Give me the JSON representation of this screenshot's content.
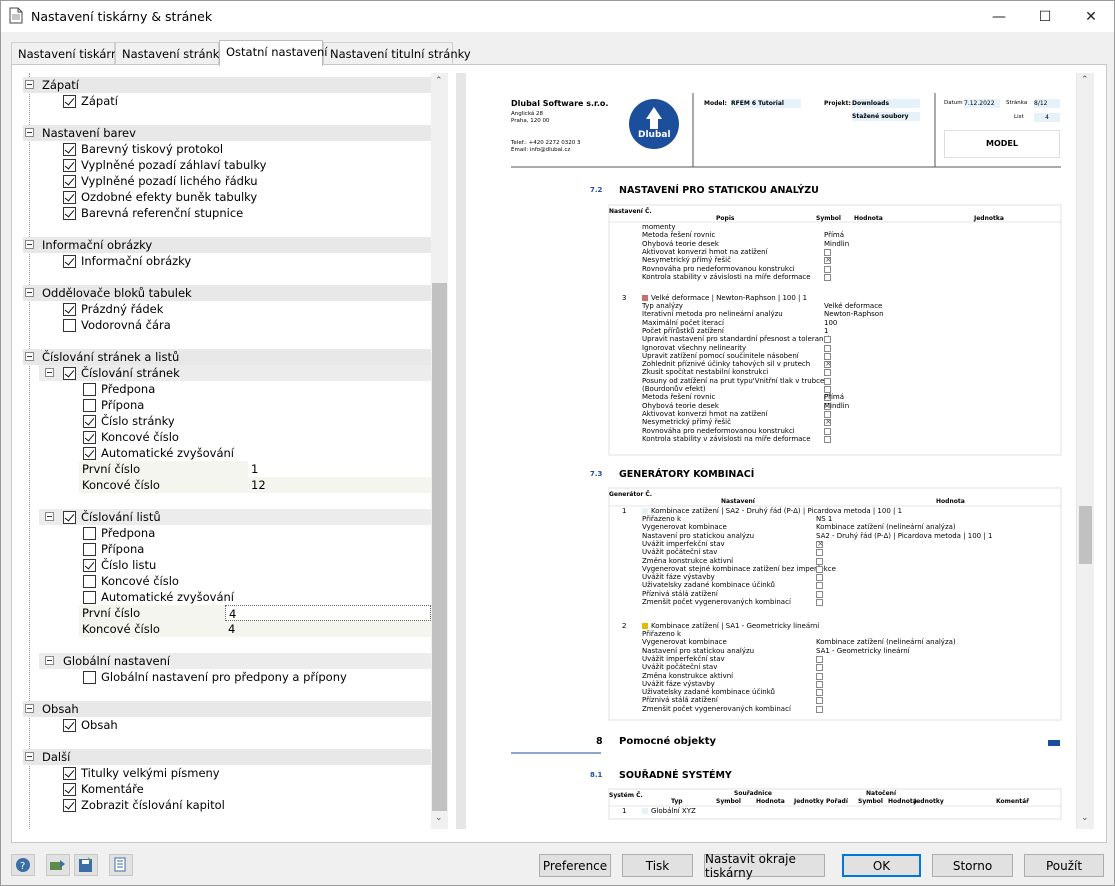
{
  "window": {
    "title": "Nastavení tiskárny & stránek",
    "minimize": "—",
    "maximize": "☐",
    "close": "✕"
  },
  "tabs": [
    "Nastavení tiskárny",
    "Nastavení stránky",
    "Ostatní nastavení",
    "Nastavení titulní stránky"
  ],
  "tree": {
    "zapati": {
      "header": "Zápatí",
      "item": "Zápatí"
    },
    "barvy": {
      "header": "Nastavení barev",
      "items": [
        "Barevný tiskový protokol",
        "Vyplněné pozadí záhlaví tabulky",
        "Vyplněné pozadí lichého řádku",
        "Ozdobné efekty buněk tabulky",
        "Barevná referenční stupnice"
      ]
    },
    "info": {
      "header": "Informační obrázky",
      "item": "Informační obrázky"
    },
    "oddelovace": {
      "header": "Oddělovače bloků tabulek",
      "items": [
        "Prázdný řádek",
        "Vodorovná čára"
      ]
    },
    "cislovani": {
      "header": "Číslování stránek a listů",
      "stranky": {
        "label": "Číslování stránek",
        "items": [
          "Předpona",
          "Přípona",
          "Číslo stránky",
          "Koncové číslo",
          "Automatické zvyšování"
        ],
        "first_label": "První číslo",
        "first_value": "1",
        "end_label": "Koncové číslo",
        "end_value": "12"
      },
      "listy": {
        "label": "Číslování listů",
        "items": [
          "Předpona",
          "Přípona",
          "Číslo listu",
          "Koncové číslo",
          "Automatické zvyšování"
        ],
        "first_label": "První číslo",
        "first_value": "4",
        "end_label": "Koncové číslo",
        "end_value": "4"
      },
      "globalni": {
        "label": "Globální nastavení",
        "item": "Globální nastavení pro předpony a přípony"
      }
    },
    "obsah": {
      "header": "Obsah",
      "item": "Obsah"
    },
    "dalsi": {
      "header": "Další",
      "items": [
        "Titulky velkými písmeny",
        "Komentáře",
        "Zobrazit číslování kapitol"
      ]
    }
  },
  "preview": {
    "company": "Dlubal Software s.r.o.",
    "address1": "Anglická 28",
    "address2": "Praha, 120 00",
    "phone": "Telef.: +420 2272 0320 3",
    "email": "Email: info@dlubal.cz",
    "logo_text": "Dlubal",
    "model_label": "Model:",
    "model_value": "RFEM 6 Tutorial",
    "project_label": "Projekt:",
    "project_value1": "Downloads",
    "project_value2": "Stažené soubory",
    "date_label": "Datum",
    "date_value": "7.12.2022",
    "page_label": "Stránka",
    "page_value": "8/12",
    "sheet_label": "List",
    "sheet_value": "4",
    "block_title": "MODEL",
    "s72_num": "7.2",
    "s72_title": "NASTAVENÍ PRO STATICKOU ANALÝZU",
    "s72_cols": [
      "Nastavení Č.",
      "Popis",
      "Symbol",
      "Hodnota",
      "Jednotka"
    ],
    "s72_rows_a": [
      "momenty",
      "Metoda řešení rovnic",
      "Ohybová teorie desek",
      "Aktivovat konverzi hmot na zatížení",
      "Nesymetrický přímý řešič",
      "Rovnováha pro nedeformovanou konstrukci",
      "Kontrola stability v závislosti na míře deformace"
    ],
    "s72_vals_a": [
      "",
      "Přímá",
      "Mindlin"
    ],
    "s72_row3_num": "3",
    "s72_row3_title": "Velké deformace | Newton-Raphson | 100 | 1",
    "s72_rows_b": [
      "Typ analýzy",
      "Iterativní metoda pro nelineární analýzu",
      "Maximální počet iterací",
      "Počet přírůstků zatížení",
      "Upravit nastavení pro standardní přesnost a toleranci",
      "Ignorovat všechny nelinearity",
      "Upravit zatížení pomocí součinitele násobení",
      "Zohlednit příznivé účinky tahových sil v prutech",
      "Zkusit spočítat nestabilní konstrukci",
      "Posuny od zatížení na prut typu'Vnitřní tlak v trubce'",
      "(Bourdonův efekt)",
      "Metoda řešení rovnic",
      "Ohybová teorie desek",
      "Aktivovat konverzi hmot na zatížení",
      "Nesymetrický přímý řešič",
      "Rovnováha pro nedeformovanou konstrukci",
      "Kontrola stability v závislosti na míře deformace"
    ],
    "s72_vals_b": [
      "Velké deformace",
      "Newton-Raphson",
      "100",
      "1"
    ],
    "s72_vals_b2": [
      "Přímá",
      "Mindlin"
    ],
    "s73_num": "7.3",
    "s73_title": "GENERÁTORY KOMBINACÍ",
    "s73_cols": [
      "Generátor Č.",
      "Nastavení",
      "Hodnota"
    ],
    "s73_g1_num": "1",
    "s73_g1_title": "Kombinace zatížení | SA2 - Druhý řád (P-Δ) | Picardova metoda | 100 | 1",
    "s73_g1_rows": [
      "Přiřazeno k",
      "Vygenerovat kombinace",
      "Nastavení pro statickou analýzu",
      "Uvážit imperfekční stav",
      "Uvážit počáteční stav",
      "Změna konstrukce aktivní",
      "Vygenerovat stejné kombinace zatížení bez imperfekce",
      "Uvážit fáze výstavby",
      "Uživatelsky zadané kombinace účinků",
      "Příznivá stálá zatížení",
      "Zmenšit počet vygenerovaných kombinací"
    ],
    "s73_g1_vals": [
      "NS 1",
      "Kombinace zatížení (nelineární analýza)",
      "SA2 - Druhý řád (P-Δ) | Picardova metoda | 100 | 1"
    ],
    "s73_g2_num": "2",
    "s73_g2_title": "Kombinace zatížení | SA1 - Geometricky lineární",
    "s73_g2_rows": [
      "Přiřazeno k",
      "Vygenerovat kombinace",
      "Nastavení pro statickou analýzu",
      "Uvážit imperfekční stav",
      "Uvážit počáteční stav",
      "Změna konstrukce aktivní",
      "Uvážit fáze výstavby",
      "Uživatelsky zadané kombinace účinků",
      "Příznivá stálá zatížení",
      "Zmenšit počet vygenerovaných kombinací"
    ],
    "s73_g2_vals": [
      "",
      "Kombinace zatížení (nelineární analýza)",
      "SA1 - Geometricky lineární"
    ],
    "s8_num": "8",
    "s8_title": "Pomocné objekty",
    "s81_num": "8.1",
    "s81_title": "SOUŘADNÉ SYSTÉMY",
    "s81_cols": [
      "Systém Č.",
      "Typ",
      "Souřadnice",
      "Symbol",
      "Hodnota",
      "Jednotky",
      "Natočení",
      "Pořadí",
      "Symbol",
      "Hodnota",
      "Jednotky",
      "Komentář"
    ],
    "s81_row_num": "1",
    "s81_row_type": "Globální XYZ"
  },
  "buttons": {
    "preference": "Preference",
    "print": "Tisk",
    "margins": "Nastavit okraje tiskárny",
    "ok": "OK",
    "cancel": "Storno",
    "apply": "Použít"
  },
  "colors": {
    "accent": "#0078d7",
    "logo_blue": "#1b4f9c",
    "preview_bg": "#e6e6e6",
    "section_bg": "#e8e8e8",
    "value_bg": "#f5f5ef"
  }
}
